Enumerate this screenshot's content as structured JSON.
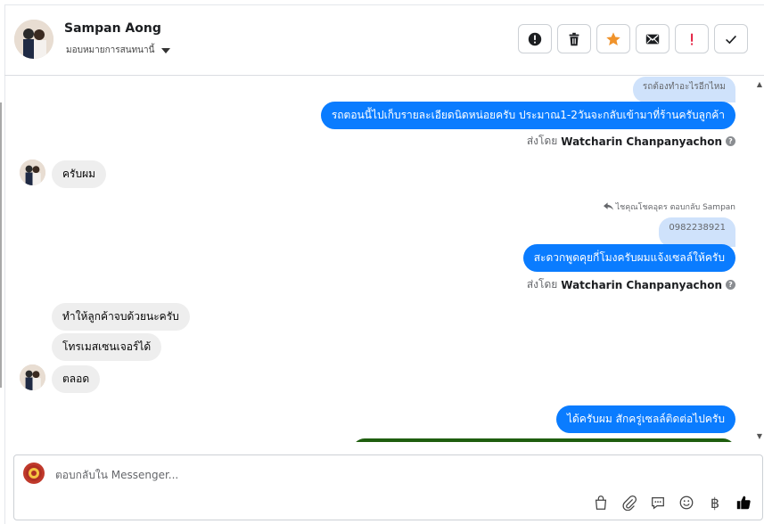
{
  "header": {
    "contact_name": "Sampan Aong",
    "assign_label": "มอบหมายการสนทนานี้"
  },
  "actions": [
    {
      "name": "report-icon"
    },
    {
      "name": "trash-icon"
    },
    {
      "name": "star-icon"
    },
    {
      "name": "mail-icon"
    },
    {
      "name": "exclamation-icon"
    },
    {
      "name": "check-icon"
    }
  ],
  "messages": {
    "quote1": "รถต้องทำอะไรอีกไหม",
    "out1": "รถตอนนี้ไปเก็บรายละเอียดนิดหน่อยครับ ประมาณ1-2วันจะกลับเข้ามาที่ร้านครับลูกค้า",
    "sent_by_prefix": "ส่งโดย",
    "sent_by_name": "Watcharin Chanpanyachon",
    "in1": "ครับผม",
    "reply_note": "ไชคุณโชคอุดร ตอบกลับ Sampan",
    "quote2": "0982238921",
    "out2": "สะดวกพูดคุยกี่โมงครับผมแจ้งเซลล์ให้ครับ",
    "in2": "ทำให้ลูกค้าจบด้วยนะครับ",
    "in3": "โทรเมสเซนเจอร์ได้",
    "in4": "ตลอด",
    "out3": "ได้ครับผม สักครู่เซลล์ติดต่อไปครับ"
  },
  "composer": {
    "placeholder": "ตอบกลับใน Messenger...",
    "currency_symbol": "฿"
  },
  "colors": {
    "outgoing": "#0a7cff",
    "incoming": "#eeeeee",
    "quoted": "#cfe2fb",
    "star": "#f0932b",
    "exclamation": "#e41e3f",
    "like": "#050505"
  }
}
